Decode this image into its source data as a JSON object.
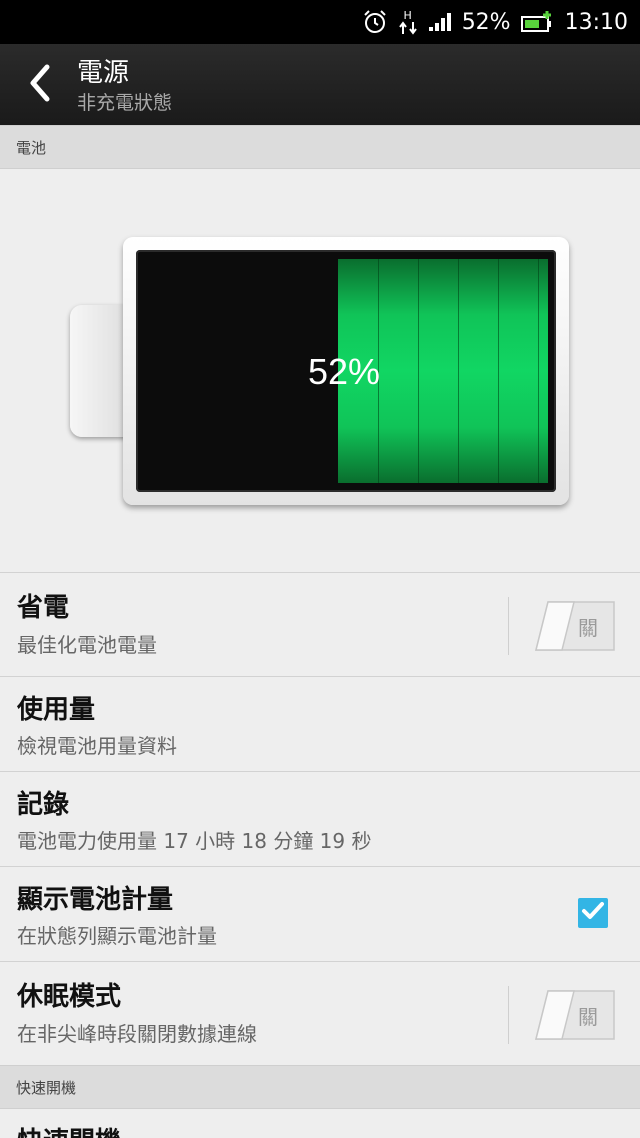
{
  "status_bar": {
    "battery_percent": "52%",
    "time": "13:10",
    "network_type": "H",
    "icons": [
      "alarm-icon",
      "data-arrows-icon",
      "signal-icon",
      "battery-charging-icon"
    ]
  },
  "header": {
    "title": "電源",
    "subtitle": "非充電狀態",
    "back_icon": "chevron-left-icon"
  },
  "battery_section": {
    "header": "電池",
    "level_label": "52%",
    "level_fraction": 0.52
  },
  "settings": [
    {
      "title": "省電",
      "subtitle": "最佳化電池電量",
      "control": "toggle",
      "toggle_label": "關",
      "checked": false
    },
    {
      "title": "使用量",
      "subtitle": "檢視電池用量資料"
    },
    {
      "title": "記錄",
      "subtitle": "電池電力使用量 17 小時 18 分鐘 19 秒"
    },
    {
      "title": "顯示電池計量",
      "subtitle": "在狀態列顯示電池計量",
      "control": "checkbox",
      "checked": true
    },
    {
      "title": "休眠模式",
      "subtitle": "在非尖峰時段關閉數據連線",
      "control": "toggle",
      "toggle_label": "關",
      "checked": false
    }
  ],
  "quick_boot_section": {
    "header": "快速開機",
    "item_title": "快速開機"
  },
  "colors": {
    "accent": "#33b5e5",
    "battery_green": "#11d663"
  }
}
